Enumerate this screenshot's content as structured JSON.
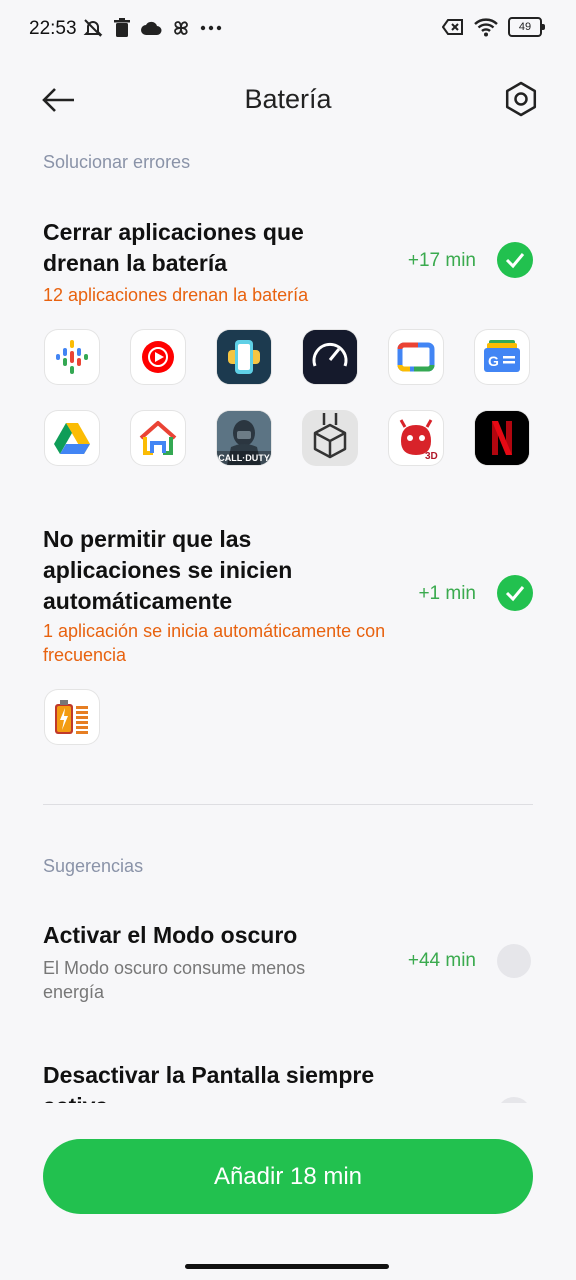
{
  "status_bar": {
    "time": "22:53",
    "battery_level": "49",
    "icons_left": [
      "mute-off-icon",
      "trash-icon",
      "cloud-icon",
      "pinwheel-icon",
      "more-dots-icon"
    ],
    "icons_right": [
      "no-sim-icon",
      "wifi-icon",
      "battery-icon"
    ]
  },
  "header": {
    "title": "Batería",
    "back_icon": "arrow-left-icon",
    "settings_icon": "settings-gear-icon"
  },
  "sections": {
    "troubleshoot_label": "Solucionar errores",
    "suggestions_label": "Sugerencias"
  },
  "items": {
    "close_apps": {
      "title": "Cerrar aplicaciones que drenan la batería",
      "subtitle": "12 aplicaciones drenan la batería",
      "gain": "+17 min",
      "checked": true,
      "apps": [
        "google-podcasts-icon",
        "youtube-music-icon",
        "app-icon-teal",
        "speedtest-icon",
        "google-tv-icon",
        "google-news-icon",
        "google-drive-icon",
        "google-home-icon",
        "call-of-duty-icon",
        "package-box-icon",
        "antutu-3d-icon",
        "netflix-icon"
      ],
      "call_of_duty_label": "CALL·DUTY",
      "antutu_label": "3D"
    },
    "auto_start": {
      "title": "No permitir que las aplicaciones se inicien automáticamente",
      "subtitle": "1 aplicación se inicia automáticamente con frecuencia",
      "gain": "+1 min",
      "checked": true,
      "apps": [
        "battery-app-icon"
      ]
    },
    "dark_mode": {
      "title": "Activar el Modo oscuro",
      "subtitle": "El Modo oscuro consume menos energía",
      "gain": "+44 min",
      "checked": false
    },
    "always_on": {
      "title": "Desactivar la Pantalla siempre activa",
      "checked": false
    }
  },
  "cta": {
    "label": "Añadir 18 min"
  },
  "colors": {
    "accent": "#22c14f",
    "warning": "#e8620f",
    "gain": "#3aaa4e",
    "section": "#8a93a8"
  }
}
